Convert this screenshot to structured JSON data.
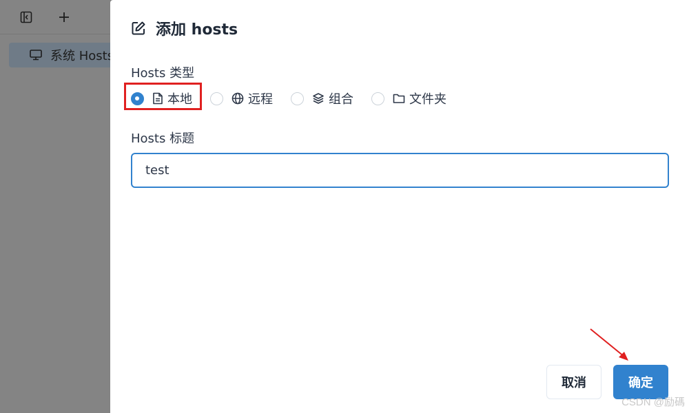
{
  "app": {
    "sidebar_item_label": "系统 Hosts"
  },
  "dialog": {
    "title": "添加 hosts",
    "type_label": "Hosts 类型",
    "type_options": [
      {
        "label": "本地",
        "icon": "file-icon",
        "selected": true
      },
      {
        "label": "远程",
        "icon": "globe-icon",
        "selected": false
      },
      {
        "label": "组合",
        "icon": "layers-icon",
        "selected": false
      },
      {
        "label": "文件夹",
        "icon": "folder-icon",
        "selected": false
      }
    ],
    "title_label": "Hosts 标题",
    "title_value": "test",
    "cancel_label": "取消",
    "ok_label": "确定"
  },
  "colors": {
    "accent": "#3182ce",
    "annotation": "#e02020"
  },
  "watermark": "CSDN @励碼"
}
